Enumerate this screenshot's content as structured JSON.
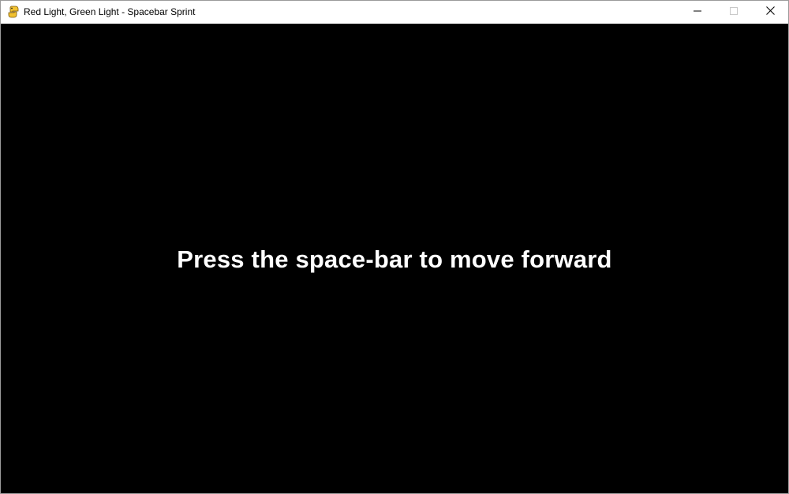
{
  "window": {
    "title": "Red Light, Green Light - Spacebar Sprint",
    "icon": "pygame-snake-icon",
    "controls": {
      "minimize_icon": "minimize-icon",
      "maximize_icon": "maximize-icon",
      "close_icon": "close-icon"
    }
  },
  "game": {
    "background_color": "#000000",
    "text_color": "#ffffff",
    "prompt": "Press the space-bar to move forward"
  }
}
